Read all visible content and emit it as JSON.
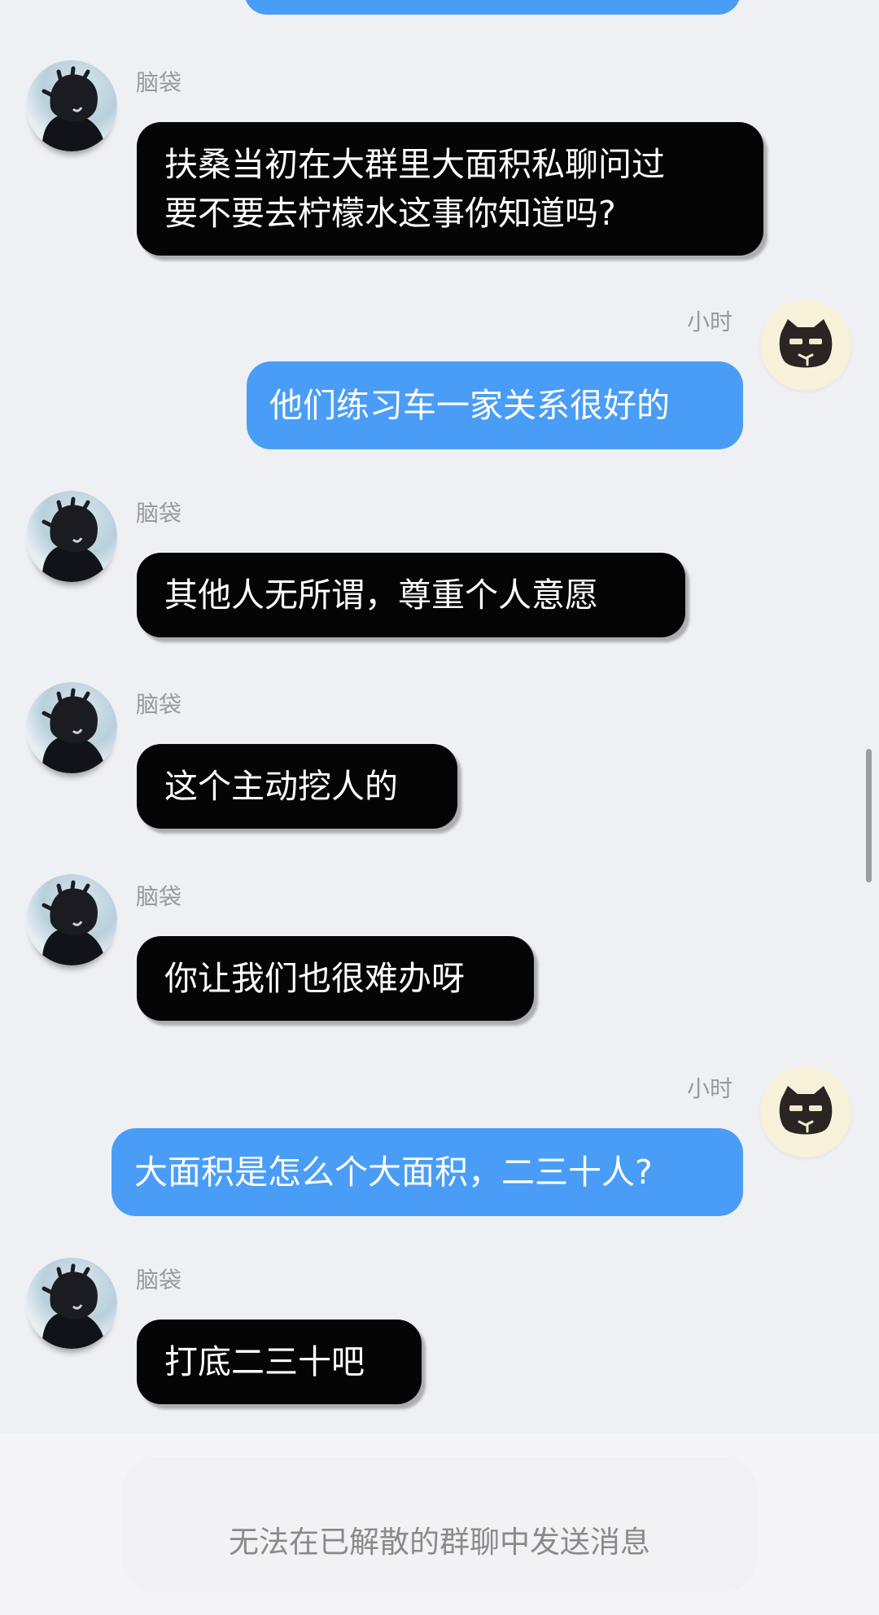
{
  "conversation": {
    "messages": [
      {
        "side": "left",
        "sender": "脑袋",
        "text": "扶桑当初在大群里大面积私聊问过\n要不要去柠檬水这事你知道吗?",
        "avatar": "dark-haired-person-avatar"
      },
      {
        "side": "right",
        "sender": "小时",
        "text": "他们练习车一家关系很好的",
        "avatar": "black-cat-avatar"
      },
      {
        "side": "left",
        "sender": "脑袋",
        "text": "其他人无所谓，尊重个人意愿",
        "avatar": "dark-haired-person-avatar"
      },
      {
        "side": "left",
        "sender": "脑袋",
        "text": "这个主动挖人的",
        "avatar": "dark-haired-person-avatar"
      },
      {
        "side": "left",
        "sender": "脑袋",
        "text": "你让我们也很难办呀",
        "avatar": "dark-haired-person-avatar"
      },
      {
        "side": "right",
        "sender": "小时",
        "text": "大面积是怎么个大面积，二三十人?",
        "avatar": "black-cat-avatar"
      },
      {
        "side": "left",
        "sender": "脑袋",
        "text": "打底二三十吧",
        "avatar": "dark-haired-person-avatar"
      }
    ]
  },
  "footer": {
    "notice": "无法在已解散的群聊中发送消息"
  },
  "colors": {
    "background": "#eef0f4",
    "left_bubble": "#050505",
    "right_bubble": "#4a9df6",
    "sender_name": "#9a9a9e"
  }
}
